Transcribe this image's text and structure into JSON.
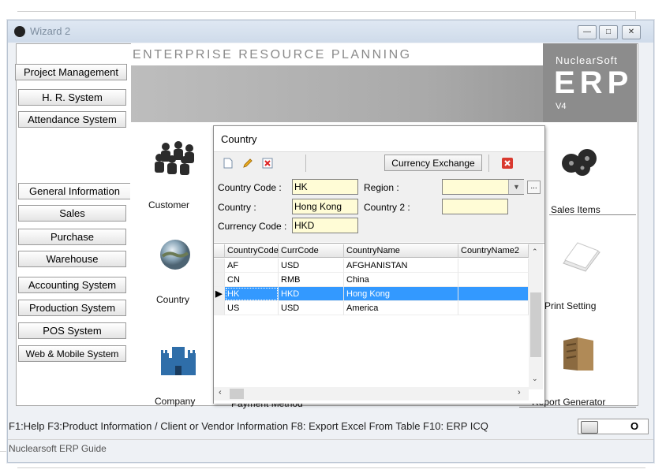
{
  "window": {
    "title": "Wizard 2",
    "controls": [
      "minimize",
      "maximize",
      "close"
    ]
  },
  "sidebar": {
    "top_buttons": [
      "Project Management",
      "H. R. System",
      "Attendance System"
    ],
    "middle_buttons": [
      "General Information",
      "Sales",
      "Purchase",
      "Warehouse"
    ],
    "bottom_buttons": [
      "Accounting System",
      "Production System",
      "POS System",
      "Web & Mobile System"
    ]
  },
  "banner": {
    "heading": "ENTERPRISE RESOURCE PLANNING",
    "brand": "NuclearSoft",
    "product": "ERP",
    "version": "V4"
  },
  "tiles": {
    "customer": "Customer",
    "country": "Country",
    "company": "Company",
    "payment_method": "Payment Method",
    "sales_items": "Sales Items",
    "print_setting": "Print Setting",
    "report_generator": "Report Generator"
  },
  "status_bar": {
    "help_text": "F1:Help  F3:Product Information / Client or Vendor Information   F8: Export Excel From Table   F10: ERP ICQ",
    "toggle_value": "O",
    "guide": "Nuclearsoft ERP Guide"
  },
  "dialog": {
    "title": "Country",
    "toolbar": {
      "new_icon": "new-document-icon",
      "edit_icon": "pencil-icon",
      "delete_icon": "delete-icon",
      "currency_exchange_label": "Currency Exchange",
      "close_icon": "close-icon"
    },
    "form": {
      "country_code_label": "Country Code :",
      "country_code_value": "HK",
      "region_label": "Region :",
      "region_value": "",
      "country_label": "Country :",
      "country_value": "Hong Kong",
      "country2_label": "Country 2 :",
      "country2_value": "",
      "currency_code_label": "Currency Code :",
      "currency_code_value": "HKD",
      "region_more": "..."
    },
    "grid": {
      "columns": [
        "CountryCode",
        "CurrCode",
        "CountryName",
        "CountryName2"
      ],
      "rows": [
        [
          "AF",
          "USD",
          "AFGHANISTAN",
          ""
        ],
        [
          "CN",
          "RMB",
          "China",
          ""
        ],
        [
          "HK",
          "HKD",
          "Hong Kong",
          ""
        ],
        [
          "US",
          "USD",
          "America",
          ""
        ]
      ],
      "selected_index": 2
    }
  },
  "colors": {
    "selection": "#3399ff",
    "input_bg": "#fffcd6",
    "banner_grey": "#a9a9a9"
  }
}
